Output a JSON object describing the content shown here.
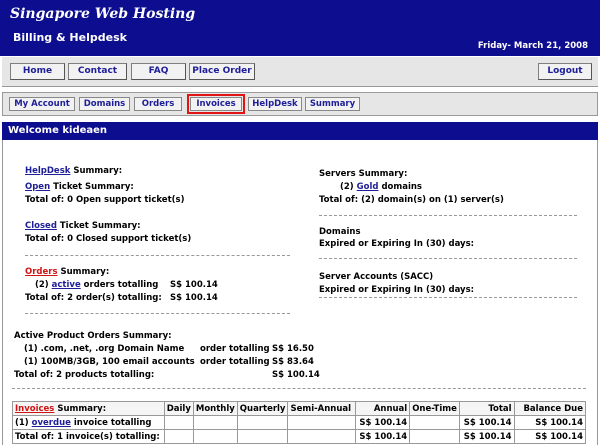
{
  "header": {
    "brand": "Singapore Web Hosting",
    "subtitle": "Billing & Helpdesk",
    "date": "Friday- March 21, 2008"
  },
  "nav": {
    "home": "Home",
    "contact": "Contact",
    "faq": "FAQ",
    "place_order": "Place Order",
    "logout": "Logout"
  },
  "tabs": {
    "my_account": "My Account",
    "domains": "Domains",
    "orders": "Orders",
    "invoices": "Invoices",
    "helpdesk": "HelpDesk",
    "summary": "Summary"
  },
  "welcome": "Welcome kideaen",
  "helpdesk": {
    "link": "HelpDesk",
    "label": " Summary:",
    "open_link": "Open",
    "open_label": " Ticket Summary:",
    "open_total": "Total of: 0 Open support ticket(s)",
    "closed_link": "Closed",
    "closed_label": " Ticket Summary:",
    "closed_total": "Total of: 0 Closed support ticket(s)"
  },
  "orders": {
    "link": "Orders",
    "label": " Summary:",
    "count": "(2)",
    "active_link": "active",
    "active_text": " orders totalling",
    "active_amount": "S$ 100.14",
    "total_text": "Total of: 2 order(s) totalling:",
    "total_amount": "S$ 100.14"
  },
  "servers": {
    "title": "Servers Summary:",
    "count": "(2)",
    "gold_link": "Gold",
    "gold_text": " domains",
    "total": "Total of: (2) domain(s) on (1) server(s)",
    "domains_title": "Domains",
    "domains_expiry": "Expired or Expiring In (30) days:",
    "accounts_title": "Server Accounts (SACC)",
    "accounts_expiry": "Expired or Expiring In (30) days:"
  },
  "product_orders": {
    "title": "Active Product Orders Summary:",
    "items": [
      {
        "label": "(1) .com, .net, .org Domain Name",
        "text": "order totalling",
        "amount": "S$ 16.50"
      },
      {
        "label": "(1) 100MB/3GB, 100 email accounts",
        "text": "order totalling",
        "amount": "S$ 83.64"
      }
    ],
    "total_text": "Total of: 2 products totalling:",
    "total_amount": "S$ 100.14"
  },
  "invoices_table": {
    "headers": {
      "summary_link": "Invoices",
      "summary_label": " Summary:",
      "daily": "Daily",
      "monthly": "Monthly",
      "quarterly": "Quarterly",
      "semi_annual": "Semi-Annual",
      "annual": "Annual",
      "one_time": "One-Time",
      "total": "Total",
      "balance_due": "Balance Due"
    },
    "row": {
      "count": "(1)",
      "overdue_link": "overdue",
      "overdue_text": " invoice totalling",
      "annual": "S$ 100.14",
      "total": "S$ 100.14",
      "balance": "S$ 100.14"
    },
    "total_row": {
      "label": "Total of: 1 invoice(s) totalling:",
      "annual": "S$ 100.14",
      "total": "S$ 100.14",
      "balance": "S$ 100.14"
    }
  }
}
